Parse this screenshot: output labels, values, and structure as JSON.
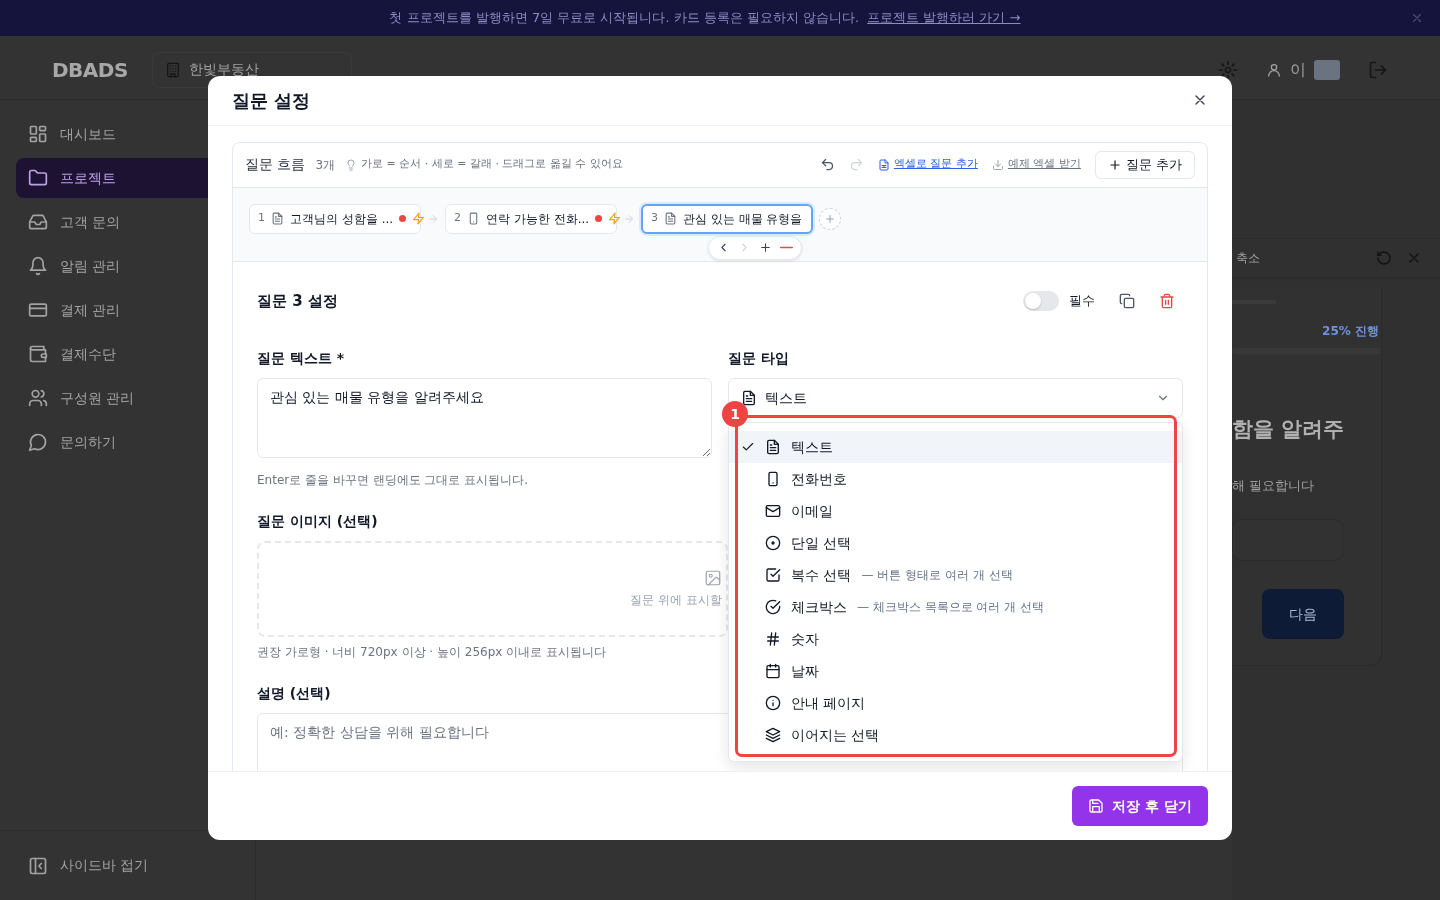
{
  "banner": {
    "text": "첫 프로젝트를 발행하면 7일 무료로 시작됩니다. 카드 등록은 필요하지 않습니다.",
    "link": "프로젝트 발행하러 가기 →"
  },
  "header": {
    "logo": "DBADS",
    "workspace": "한빛부동산",
    "user_initial": "이"
  },
  "sidebar": {
    "items": [
      {
        "label": "대시보드",
        "selected": false
      },
      {
        "label": "프로젝트",
        "selected": true
      },
      {
        "label": "고객 문의",
        "selected": false
      },
      {
        "label": "알림 관리",
        "selected": false
      },
      {
        "label": "결제 관리",
        "selected": false
      },
      {
        "label": "결제수단",
        "selected": false
      },
      {
        "label": "구성원 관리",
        "selected": false
      },
      {
        "label": "문의하기",
        "selected": false
      }
    ],
    "collapse": "사이드바 접기"
  },
  "preview": {
    "shrink": "축소",
    "progress": "25% 진행",
    "heading": "함을 알려주",
    "description": "해 필요합니다",
    "next": "다음"
  },
  "modal": {
    "title": "질문 설정",
    "flow": {
      "title": "질문 흐름",
      "count": "3개",
      "hint": "가로 = 순서 · 세로 = 갈래 · 드래그로 옮길 수 있어요",
      "undo_disabled": false,
      "redo_disabled": true,
      "excel_import": "엑셀로 질문 추가",
      "excel_sample": "예제 엑셀 받기",
      "add": "질문 추가",
      "nodes": [
        {
          "number": "1",
          "kind": "text",
          "label": "고객님의 성함을 ...",
          "required": true,
          "logic": true,
          "selected": false
        },
        {
          "number": "2",
          "kind": "phone",
          "label": "연락 가능한 전화...",
          "required": true,
          "logic": true,
          "selected": false
        },
        {
          "number": "3",
          "kind": "text",
          "label": "관심 있는 매물 유형을",
          "required": false,
          "logic": false,
          "selected": true
        }
      ],
      "node_toolbar": {
        "prev_disabled": false,
        "next_disabled": true
      }
    },
    "editor": {
      "title": "질문 3 설정",
      "required": {
        "label": "필수",
        "on": false
      },
      "question_label": "질문 텍스트 *",
      "question_value": "관심 있는 매물 유형을 알려주세요",
      "question_hint": "Enter로 줄을 바꾸면 랜딩에도 그대로 표시됩니다.",
      "type_label": "질문 타입",
      "type_value": "텍스트",
      "type_options": [
        {
          "kind": "text",
          "label": "텍스트",
          "selected": true
        },
        {
          "kind": "phone",
          "label": "전화번호",
          "selected": false
        },
        {
          "kind": "mail",
          "label": "이메일",
          "selected": false
        },
        {
          "kind": "radio",
          "label": "단일 선택",
          "selected": false
        },
        {
          "kind": "checksquare",
          "label": "복수 선택",
          "description": "— 버튼 형태로 여러 개 선택",
          "selected": false
        },
        {
          "kind": "checkcircle",
          "label": "체크박스",
          "description": "— 체크박스 목록으로 여러 개 선택",
          "selected": false
        },
        {
          "kind": "hash",
          "label": "숫자",
          "selected": false
        },
        {
          "kind": "calendar",
          "label": "날짜",
          "selected": false
        },
        {
          "kind": "info",
          "label": "안내 페이지",
          "selected": false
        },
        {
          "kind": "layers",
          "label": "이어지는 선택",
          "selected": false
        }
      ],
      "image_label": "질문 이미지 (선택)",
      "image_drop": "질문 위에 표시할",
      "image_hint": "권장 가로형 · 너비 720px 이상 · 높이 256px 이내로 표시됩니다",
      "description_label": "설명 (선택)",
      "description_placeholder": "예: 정확한 상담을 위해 필요합니다"
    },
    "save": "저장 후 닫기"
  },
  "annotation": {
    "label": "1"
  }
}
